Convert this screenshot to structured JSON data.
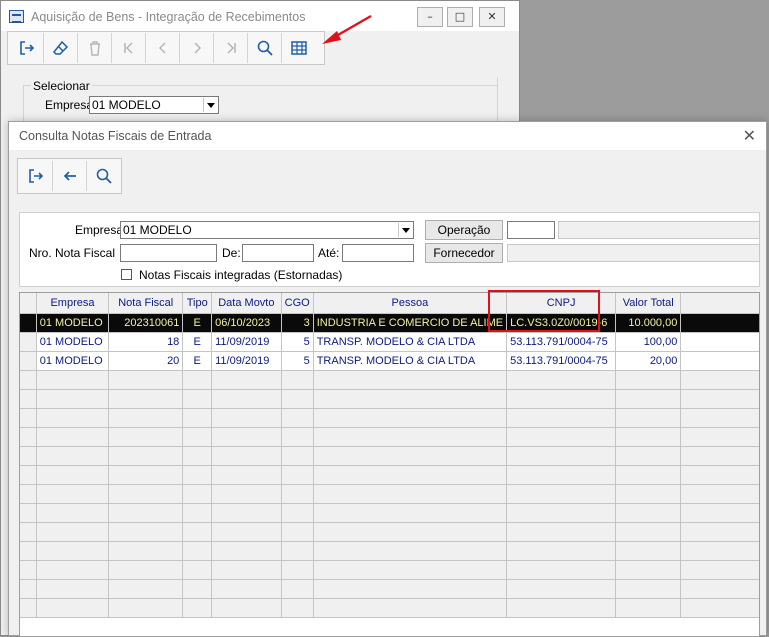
{
  "back_window": {
    "title": "Aquisição de Bens - Integração de Recebimentos",
    "window_buttons": [
      "–",
      "□",
      "✕"
    ],
    "toolbar": [
      "exit-icon",
      "eraser-icon",
      "trash-icon",
      "first-icon",
      "prev-icon",
      "next-icon",
      "last-icon",
      "search-icon",
      "table-icon"
    ],
    "group_label": "Selecionar",
    "empresa_label": "Empresa",
    "empresa_value": "01 MODELO"
  },
  "dialog": {
    "title": "Consulta Notas Fiscais de Entrada",
    "close": "✕",
    "toolbar": [
      "exit-icon",
      "back-arrow-icon",
      "search-icon"
    ],
    "filters": {
      "empresa_label": "Empresa",
      "empresa_value": "01 MODELO",
      "operacao_button": "Operação",
      "nf_label": "Nro. Nota Fiscal",
      "de_label": "De:",
      "ate_label": "Até:",
      "fornecedor_button": "Fornecedor",
      "checkbox_label": "Notas Fiscais integradas (Estornadas)"
    },
    "grid": {
      "columns": [
        "Empresa",
        "Nota Fiscal",
        "Tipo",
        "Data Movto",
        "CGO",
        "Pessoa",
        "CNPJ",
        "Valor Total"
      ],
      "rows": [
        [
          "01 MODELO",
          "202310061",
          "E",
          "06/10/2023",
          "3",
          "INDUSTRIA E COMERCIO DE ALIME",
          "LC.VS3.0Z0/0019-6",
          "10.000,00"
        ],
        [
          "01 MODELO",
          "18",
          "E",
          "11/09/2019",
          "5",
          "TRANSP. MODELO & CIA LTDA",
          "53.113.791/0004-75",
          "100,00"
        ],
        [
          "01 MODELO",
          "20",
          "E",
          "11/09/2019",
          "5",
          "TRANSP. MODELO & CIA LTDA",
          "53.113.791/0004-75",
          "20,00"
        ]
      ],
      "selected_row": 0
    }
  },
  "colors": {
    "selection_bg": "#0a0a0a",
    "selection_text": "#f2f2a0",
    "grid_text": "#0a1a82",
    "highlight": "#e0101a",
    "accent_icon": "#1f5fa8"
  }
}
